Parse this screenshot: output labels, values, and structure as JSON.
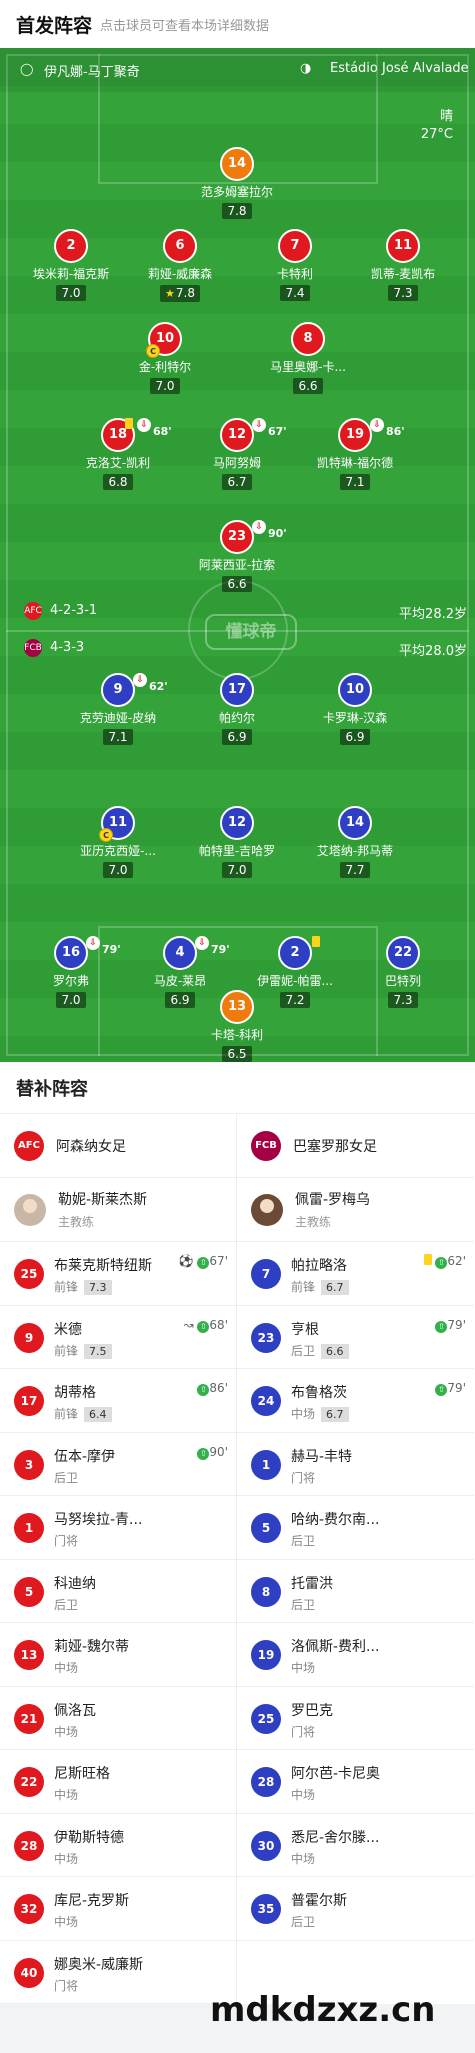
{
  "header": {
    "title": "首发阵容",
    "subtitle": "点击球员可查看本场详细数据"
  },
  "match_info": {
    "referee": "伊凡娜-马丁聚奇",
    "stadium": "Estádio José Alvalade",
    "weather": "晴",
    "temperature": "27°C"
  },
  "watermark": "懂球帝",
  "home_team": {
    "formation": "4-2-3-1",
    "avg_age": "平均28.2岁",
    "crest": "AFC"
  },
  "away_team": {
    "formation": "4-3-3",
    "avg_age": "平均28.0岁",
    "crest": "FCB"
  },
  "home_players": [
    {
      "num": "14",
      "name": "范多姆塞拉尔",
      "rating": "7.8"
    },
    {
      "num": "2",
      "name": "埃米莉-福克斯",
      "rating": "7.0"
    },
    {
      "num": "6",
      "name": "莉娅-威廉森",
      "rating": "7.8"
    },
    {
      "num": "7",
      "name": "卡特利",
      "rating": "7.4"
    },
    {
      "num": "11",
      "name": "凯蒂-麦凯布",
      "rating": "7.3"
    },
    {
      "num": "10",
      "name": "金-利特尔",
      "rating": "7.0"
    },
    {
      "num": "8",
      "name": "马里奥娜-卡...",
      "rating": "6.6"
    },
    {
      "num": "18",
      "name": "克洛艾-凯利",
      "rating": "6.8",
      "sub_time": "68'"
    },
    {
      "num": "12",
      "name": "马阿努姆",
      "rating": "6.7",
      "sub_time": "67'"
    },
    {
      "num": "19",
      "name": "凯特琳-福尔德",
      "rating": "7.1",
      "sub_time": "86'"
    },
    {
      "num": "23",
      "name": "阿莱西亚-拉索",
      "rating": "6.6",
      "sub_time": "90'"
    }
  ],
  "away_players": [
    {
      "num": "9",
      "name": "克劳迪娅-皮纳",
      "rating": "7.1",
      "sub_time": "62'"
    },
    {
      "num": "17",
      "name": "帕约尔",
      "rating": "6.9"
    },
    {
      "num": "10",
      "name": "卡罗琳-汉森",
      "rating": "6.9"
    },
    {
      "num": "11",
      "name": "亚历克西娅-...",
      "rating": "7.0"
    },
    {
      "num": "12",
      "name": "帕特里-吉哈罗",
      "rating": "7.0"
    },
    {
      "num": "14",
      "name": "艾塔纳-邦马蒂",
      "rating": "7.7"
    },
    {
      "num": "16",
      "name": "罗尔弗",
      "rating": "7.0",
      "sub_time": "79'"
    },
    {
      "num": "4",
      "name": "马皮-莱昂",
      "rating": "6.9",
      "sub_time": "79'"
    },
    {
      "num": "2",
      "name": "伊雷妮-帕雷...",
      "rating": "7.2"
    },
    {
      "num": "22",
      "name": "巴特列",
      "rating": "7.3"
    },
    {
      "num": "13",
      "name": "卡塔-科利",
      "rating": "6.5"
    }
  ],
  "subs": {
    "title": "替补阵容",
    "home": {
      "team_name": "阿森纳女足",
      "coach_name": "勒妮-斯莱杰斯",
      "coach_role": "主教练",
      "list": [
        {
          "num": "25",
          "name": "布莱克斯特纽斯",
          "pos": "前锋",
          "rating": "7.3",
          "event": "67'"
        },
        {
          "num": "9",
          "name": "米德",
          "pos": "前锋",
          "rating": "7.5",
          "event": "68'"
        },
        {
          "num": "17",
          "name": "胡蒂格",
          "pos": "前锋",
          "rating": "6.4",
          "event": "86'"
        },
        {
          "num": "3",
          "name": "伍本-摩伊",
          "pos": "后卫",
          "event": "90'"
        },
        {
          "num": "1",
          "name": "马努埃拉-青...",
          "pos": "门将"
        },
        {
          "num": "5",
          "name": "科迪纳",
          "pos": "后卫"
        },
        {
          "num": "13",
          "name": "莉娅-魏尔蒂",
          "pos": "中场"
        },
        {
          "num": "21",
          "name": "佩洛瓦",
          "pos": "中场"
        },
        {
          "num": "22",
          "name": "尼斯旺格",
          "pos": "中场"
        },
        {
          "num": "28",
          "name": "伊勒斯特德",
          "pos": "中场"
        },
        {
          "num": "32",
          "name": "库尼-克罗斯",
          "pos": "中场"
        },
        {
          "num": "40",
          "name": "娜奥米-威廉斯",
          "pos": "门将"
        }
      ]
    },
    "away": {
      "team_name": "巴塞罗那女足",
      "coach_name": "佩雷-罗梅乌",
      "coach_role": "主教练",
      "list": [
        {
          "num": "7",
          "name": "帕拉略洛",
          "pos": "前锋",
          "rating": "6.7",
          "event": "62'"
        },
        {
          "num": "23",
          "name": "亨根",
          "pos": "后卫",
          "rating": "6.6",
          "event": "79'"
        },
        {
          "num": "24",
          "name": "布鲁格茨",
          "pos": "中场",
          "rating": "6.7",
          "event": "79'"
        },
        {
          "num": "1",
          "name": "赫马-丰特",
          "pos": "门将"
        },
        {
          "num": "5",
          "name": "哈纳-费尔南...",
          "pos": "后卫"
        },
        {
          "num": "8",
          "name": "托雷洪",
          "pos": "后卫"
        },
        {
          "num": "19",
          "name": "洛佩斯-费利...",
          "pos": "中场"
        },
        {
          "num": "25",
          "name": "罗巴克",
          "pos": "门将"
        },
        {
          "num": "28",
          "name": "阿尔芭-卡尼奥",
          "pos": "中场"
        },
        {
          "num": "30",
          "name": "悉尼-舍尔滕...",
          "pos": "中场"
        },
        {
          "num": "35",
          "name": "普霍尔斯",
          "pos": "后卫"
        }
      ]
    }
  },
  "site_watermark": "mdkdzxz.cn"
}
